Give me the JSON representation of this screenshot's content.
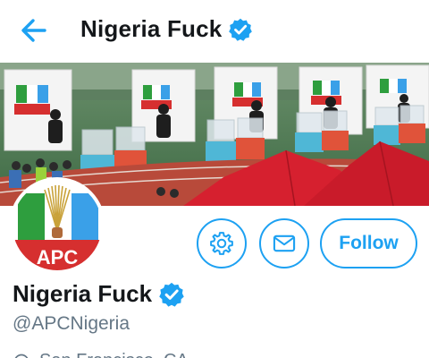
{
  "header": {
    "title": "Nigeria Fuck",
    "verified": true
  },
  "banner": {
    "description_icon": "stadium-photo"
  },
  "avatar": {
    "party_label": "APC",
    "icon": "apc-broom-logo"
  },
  "actions": {
    "settings_icon": "gear-icon",
    "message_icon": "envelope-icon",
    "follow_label": "Follow"
  },
  "profile": {
    "name": "Nigeria Fuck",
    "handle": "@APCNigeria",
    "location": "San Francisco, CA"
  },
  "colors": {
    "accent": "#1da1f2",
    "text_primary": "#14171a",
    "text_secondary": "#657786"
  }
}
